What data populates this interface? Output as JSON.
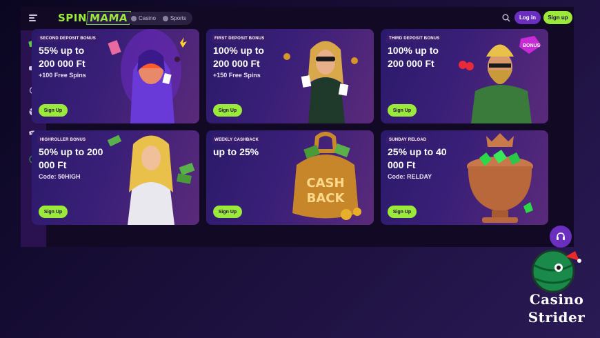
{
  "header": {
    "logo": {
      "part1": "SPIN",
      "part2": "MAMA"
    },
    "nav": [
      {
        "label": "Casino",
        "icon": "casino-icon"
      },
      {
        "label": "Sports",
        "icon": "sports-icon"
      }
    ],
    "login_label": "Log in",
    "signup_label": "Sign up"
  },
  "sidebar": {
    "items": [
      {
        "icon": "cash-icon"
      },
      {
        "icon": "chat-bubbles-icon"
      },
      {
        "icon": "live-broadcast-icon"
      },
      {
        "icon": "ball-icon"
      },
      {
        "icon": "game-mask-icon"
      },
      {
        "icon": "support-icon"
      }
    ]
  },
  "cards": [
    {
      "tag": "SECOND DEPOSIT BONUS",
      "line1": "55% up to",
      "line2": "200 000 Ft",
      "sub": "+100 Free Spins",
      "cta": "Sign Up",
      "art": "neon-hooded-woman"
    },
    {
      "tag": "FIRST DEPOSIT BONUS",
      "line1": "100% up to",
      "line2": "200 000 Ft",
      "sub": "+150 Free Spins",
      "cta": "Sign Up",
      "art": "woman-in-suit-with-cards"
    },
    {
      "tag": "THIRD DEPOSIT BONUS",
      "line1": "100% up to",
      "line2": "200 000 Ft",
      "sub": "",
      "cta": "Sign Up",
      "art": "bearded-man-with-bonus-gem"
    },
    {
      "tag": "HIGHROLLER BONUS",
      "line1": "50% up to 200",
      "line2": "000 Ft",
      "sub": "Code: 50HIGH",
      "cta": "Sign Up",
      "art": "woman-in-white-with-cash"
    },
    {
      "tag": "WEEKLY CASHBACK",
      "line1": "up to 25%",
      "line2": "",
      "sub": "",
      "cta": "Sign Up",
      "art": "cash-back-bag",
      "art_text1": "CASH",
      "art_text2": "BACK"
    },
    {
      "tag": "SUNDAY RELOAD",
      "line1": "25% up to 40",
      "line2": "000 Ft",
      "sub": "Code: RELDAY",
      "cta": "Sign Up",
      "art": "urn-with-emeralds"
    }
  ],
  "watermark": {
    "line1": "Casino",
    "line2": "Strider"
  },
  "colors": {
    "accent_green": "#9be93a",
    "accent_purple": "#6b2fc0",
    "bg": "#120924"
  }
}
